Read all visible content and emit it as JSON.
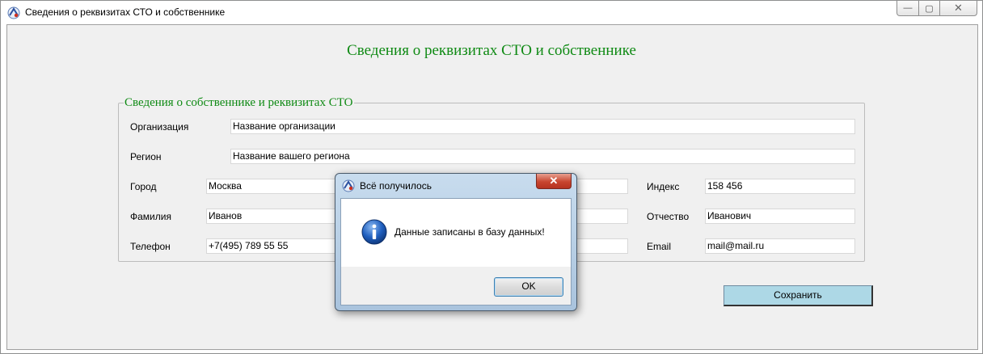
{
  "window": {
    "title": "Сведения о реквизитах СТО и собственнике",
    "minimize": "—",
    "maximize": "▢",
    "close": "✕"
  },
  "form": {
    "title": "Сведения о реквизитах СТО и собственнике",
    "group_title": "Сведения о собственнике и реквизитах СТО",
    "fields": {
      "organization": {
        "label": "Организация",
        "value": "Название организации"
      },
      "region": {
        "label": "Регион",
        "value": "Название вашего региона"
      },
      "city": {
        "label": "Город",
        "value": "Москва"
      },
      "index": {
        "label": "Индекс",
        "value": "158 456"
      },
      "surname": {
        "label": "Фамилия",
        "value": "Иванов"
      },
      "patronymic": {
        "label": "Отчество",
        "value": "Иванович"
      },
      "phone": {
        "label": "Телефон",
        "value": "+7(495) 789 55 55"
      },
      "email": {
        "label": "Email",
        "value": "mail@mail.ru"
      }
    },
    "save_label": "Сохранить"
  },
  "dialog": {
    "title": "Всё получилось",
    "message": "Данные записаны в базу данных!",
    "ok_label": "OK",
    "close": "✕"
  },
  "colors": {
    "title_green": "#0f8a14",
    "save_button": "#add8e6",
    "client_bg": "#f0f0f0"
  },
  "icons": {
    "app": "app-icon",
    "dialog_app": "app-icon",
    "info": "info-icon"
  }
}
